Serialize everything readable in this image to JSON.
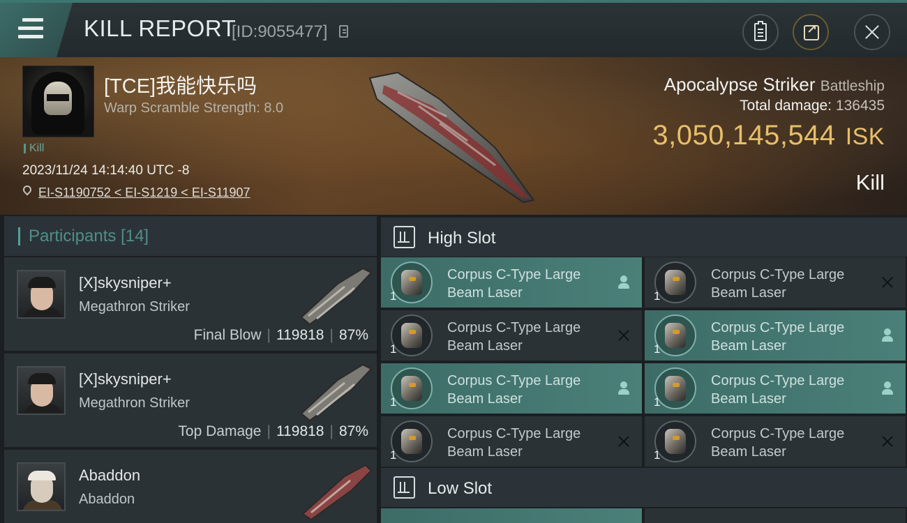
{
  "header": {
    "title": "KILL REPORT",
    "report_id": "[ID:9055477]"
  },
  "victim": {
    "pilot_name": "[TCE]我能快乐吗",
    "warp_scramble": "Warp Scramble Strength: 8.0",
    "tag": "Kill",
    "datetime": "2023/11/24 14:14:40 UTC -8",
    "location": "EI-S1190752 < EI-S1219 < EI-S11907",
    "ship_name": "Apocalypse Striker",
    "ship_class": "Battleship",
    "total_damage_label": "Total damage:",
    "total_damage": "136435",
    "isk_value": "3,050,145,544",
    "isk_unit": "ISK",
    "result": "Kill"
  },
  "participants": {
    "label": "Participants",
    "count": "[14]",
    "items": [
      {
        "name": "[X]skysniper+",
        "ship": "Megathron Striker",
        "role": "Final Blow",
        "damage": "119818",
        "percent": "87%"
      },
      {
        "name": "[X]skysniper+",
        "ship": "Megathron Striker",
        "role": "Top Damage",
        "damage": "119818",
        "percent": "87%"
      },
      {
        "name": "Abaddon",
        "ship": "Abaddon",
        "role": "",
        "damage": "",
        "percent": ""
      }
    ]
  },
  "high_slot": {
    "label": "High Slot",
    "modules": [
      {
        "qty": "1",
        "name_line1": "Corpus C-Type Large",
        "name_line2": "Beam Laser",
        "state": "fitted"
      },
      {
        "qty": "1",
        "name_line1": "Corpus C-Type Large",
        "name_line2": "Beam Laser",
        "state": "destroyed"
      },
      {
        "qty": "1",
        "name_line1": "Corpus C-Type Large",
        "name_line2": "Beam Laser",
        "state": "destroyed"
      },
      {
        "qty": "1",
        "name_line1": "Corpus C-Type Large",
        "name_line2": "Beam Laser",
        "state": "fitted"
      },
      {
        "qty": "1",
        "name_line1": "Corpus C-Type Large",
        "name_line2": "Beam Laser",
        "state": "fitted"
      },
      {
        "qty": "1",
        "name_line1": "Corpus C-Type Large",
        "name_line2": "Beam Laser",
        "state": "fitted"
      },
      {
        "qty": "1",
        "name_line1": "Corpus C-Type Large",
        "name_line2": "Beam Laser",
        "state": "destroyed"
      },
      {
        "qty": "1",
        "name_line1": "Corpus C-Type Large",
        "name_line2": "Beam Laser",
        "state": "destroyed"
      }
    ]
  },
  "low_slot": {
    "label": "Low Slot"
  },
  "colors": {
    "accent_teal": "#4a8079",
    "isk_gold": "#e8bf69",
    "panel_bg": "#2b3236"
  }
}
